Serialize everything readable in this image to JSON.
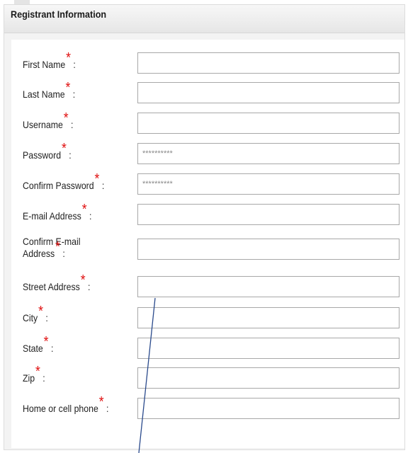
{
  "panel": {
    "title": "Registrant Information"
  },
  "fields": {
    "first_name": {
      "label": "First Name",
      "value": ""
    },
    "last_name": {
      "label": "Last Name",
      "value": ""
    },
    "username": {
      "label": "Username",
      "value": ""
    },
    "password": {
      "label": "Password",
      "value": "**********"
    },
    "confirm_password": {
      "label": "Confirm Password",
      "value": "**********"
    },
    "email": {
      "label": "E-mail Address",
      "value": ""
    },
    "confirm_email": {
      "label_line1": "Confirm E-mail",
      "label_line2": "Address",
      "value": ""
    },
    "street": {
      "label": "Street Address",
      "value": ""
    },
    "city": {
      "label": "City",
      "value": ""
    },
    "state": {
      "label": "State",
      "value": ""
    },
    "zip": {
      "label": "Zip",
      "value": ""
    },
    "phone": {
      "label": "Home or cell phone",
      "value": ""
    }
  },
  "required_mark": "*",
  "colon": ":",
  "colors": {
    "required": "#e01010",
    "pointer_line": "#2a4a8c"
  }
}
